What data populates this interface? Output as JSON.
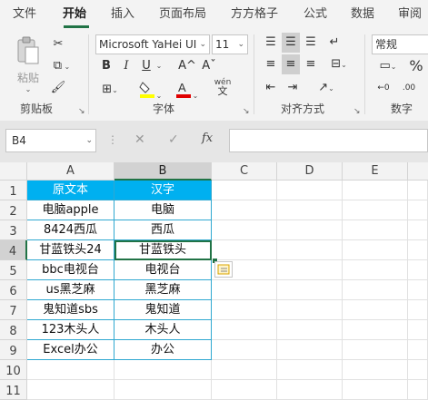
{
  "tabs": [
    "文件",
    "开始",
    "插入",
    "页面布局",
    "方方格子",
    "公式",
    "数据",
    "审阅"
  ],
  "ribbon": {
    "clipboard": {
      "label": "剪贴板",
      "paste_label": "粘贴"
    },
    "font": {
      "label": "字体",
      "name": "Microsoft YaHei UI",
      "size": "11",
      "bold": "B",
      "italic": "I",
      "underline": "U",
      "grow": "A^",
      "shrink": "Aˇ",
      "pinyin_top": "wén",
      "pinyin_bottom": "文"
    },
    "alignment": {
      "label": "对齐方式"
    },
    "number": {
      "label": "数字",
      "format": "常规",
      "percent": "%"
    }
  },
  "formula_bar": {
    "name_box": "B4",
    "cancel": "✕",
    "enter": "✓",
    "fx": "fx",
    "value": ""
  },
  "columns": [
    "A",
    "B",
    "C",
    "D",
    "E"
  ],
  "rows": [
    "1",
    "2",
    "3",
    "4",
    "5",
    "6",
    "7",
    "8",
    "9",
    "10",
    "11"
  ],
  "cells": [
    [
      "原文本",
      "汉字"
    ],
    [
      "电脑apple",
      "电脑"
    ],
    [
      "8424西瓜",
      "西瓜"
    ],
    [
      "甘蓝铁头24",
      "甘蓝铁头"
    ],
    [
      "bbc电视台",
      "电视台"
    ],
    [
      "us黑芝麻",
      "黑芝麻"
    ],
    [
      "鬼知道sbs",
      "鬼知道"
    ],
    [
      "123木头人",
      "木头人"
    ],
    [
      "Excel办公",
      "办公"
    ]
  ],
  "colors": {
    "header_fill": "#00b0f0",
    "border": "#2fa8d1",
    "accent": "#217346"
  }
}
